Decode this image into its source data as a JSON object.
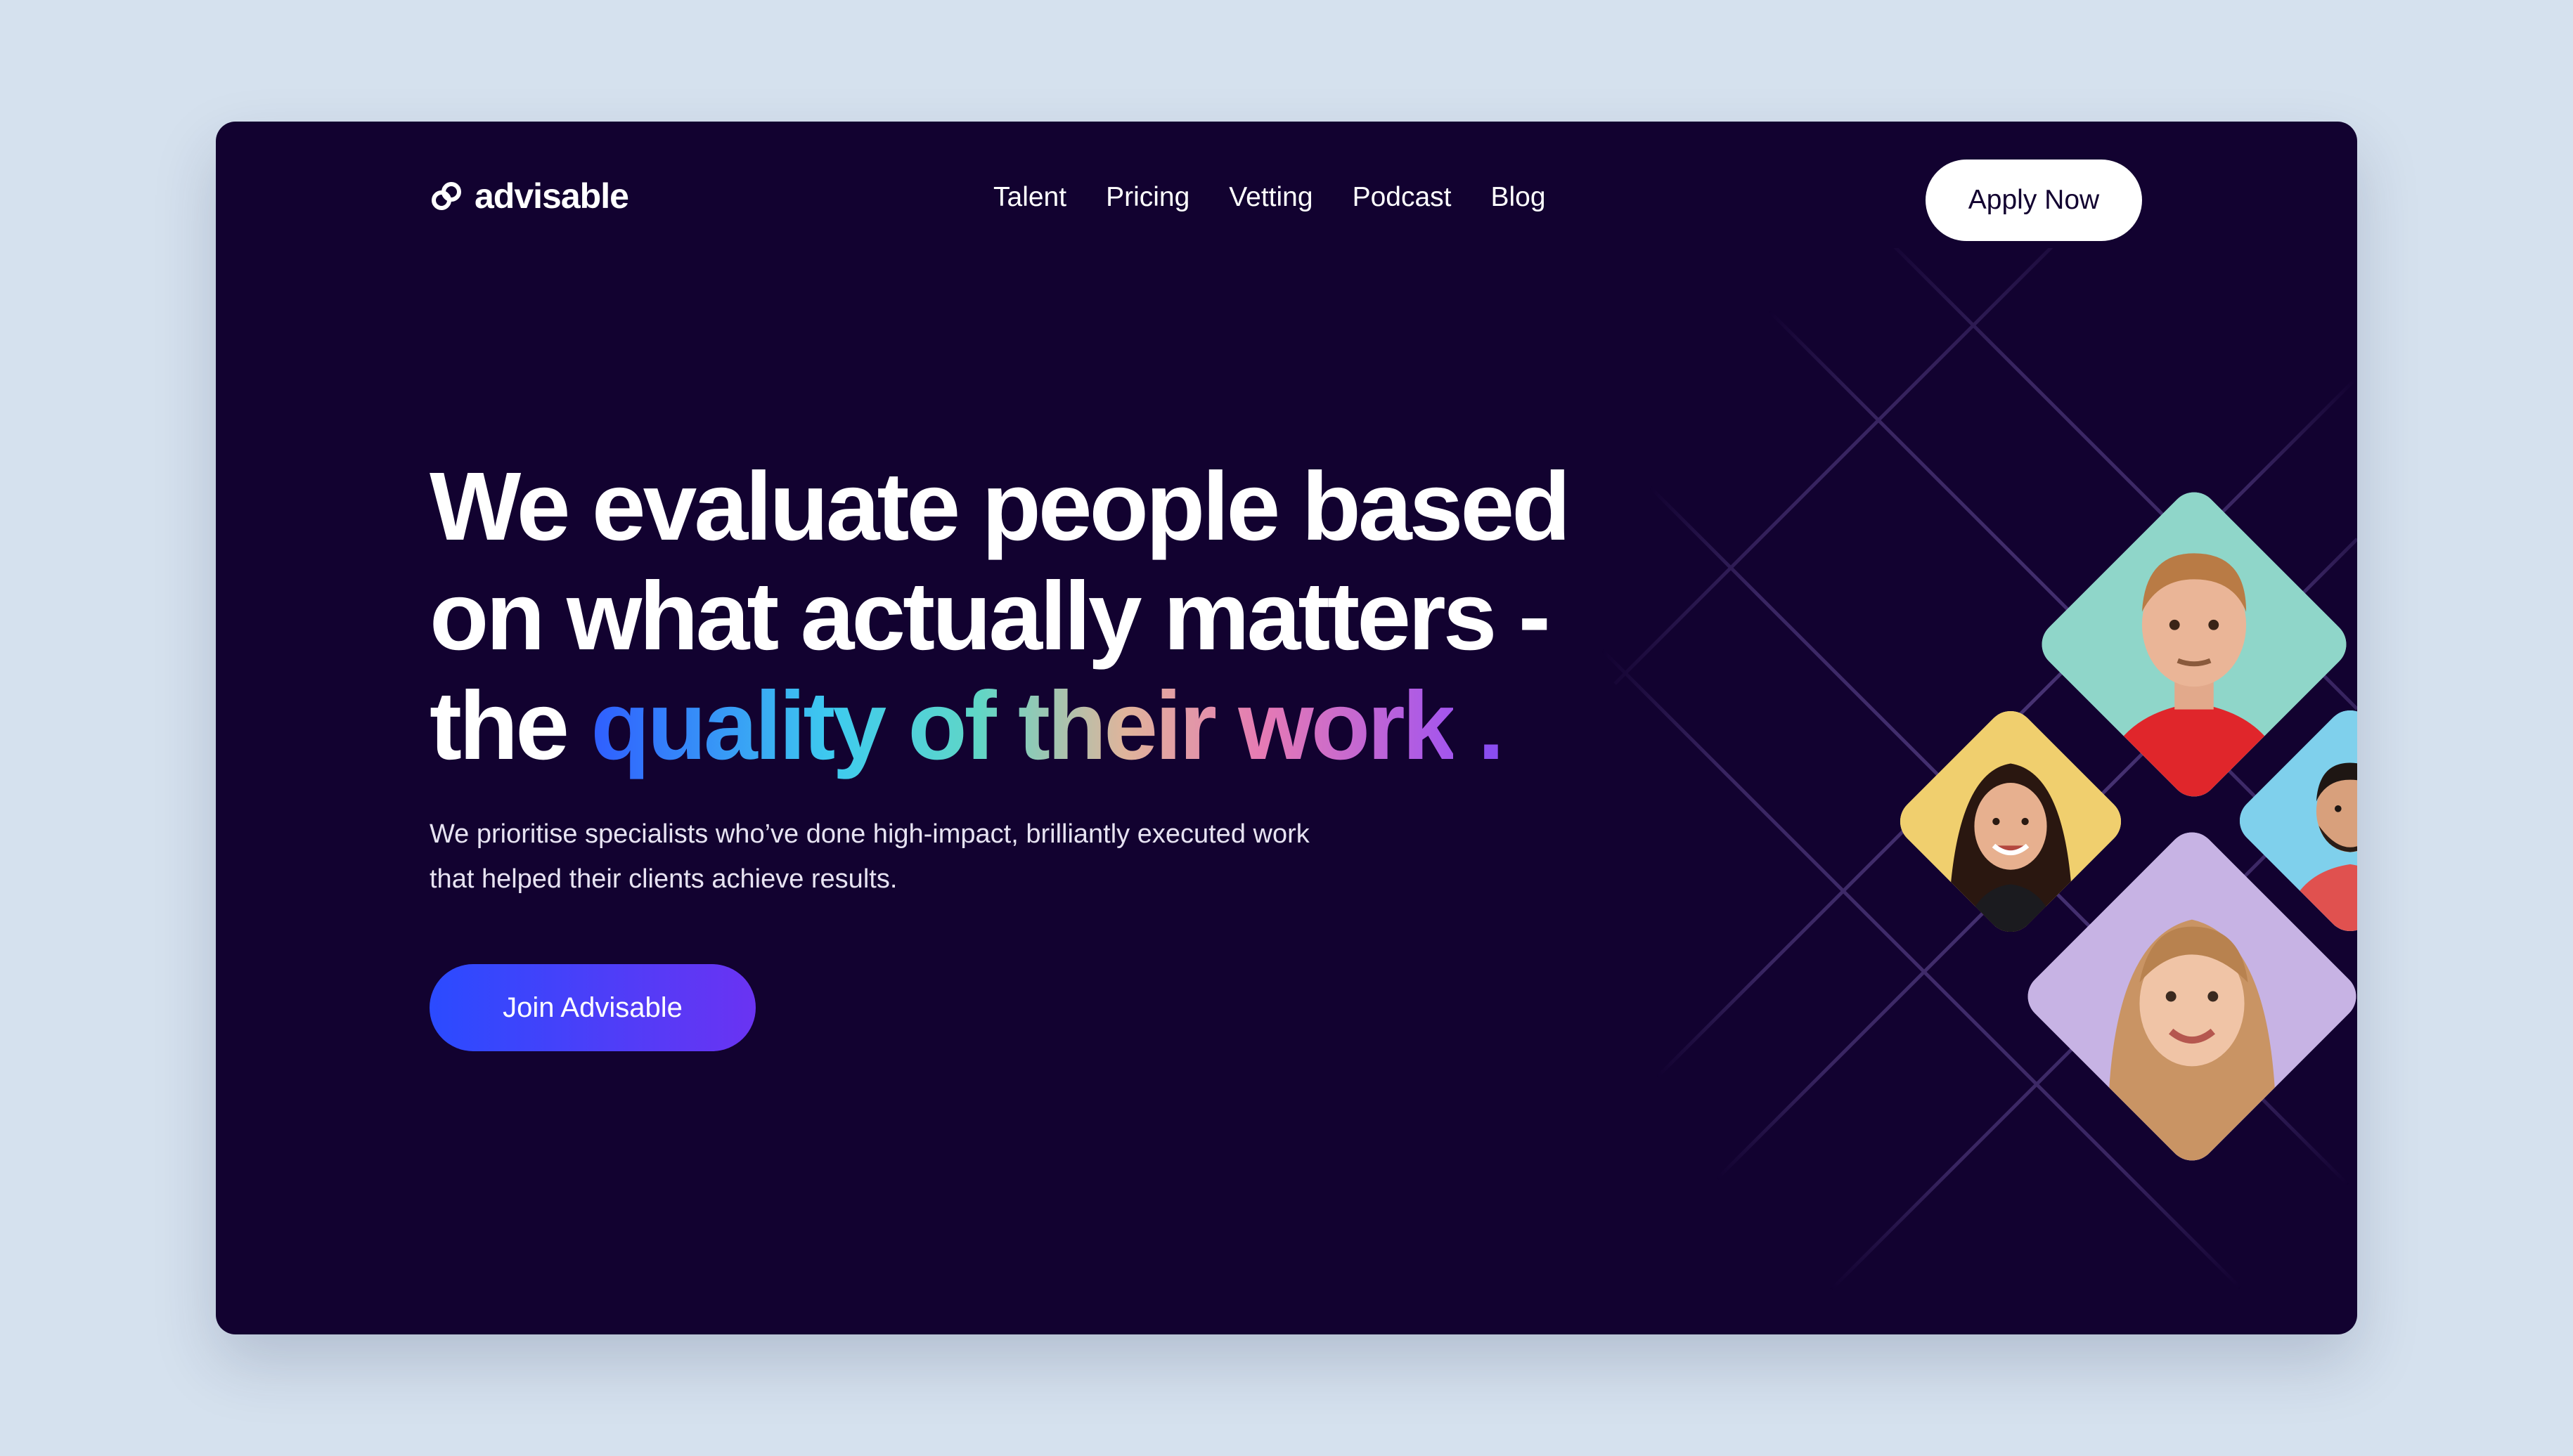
{
  "brand": {
    "name": "advisable",
    "logo_icon": "linked-rings-icon"
  },
  "nav": {
    "items": [
      "Talent",
      "Pricing",
      "Vetting",
      "Podcast",
      "Blog"
    ],
    "cta_label": "Apply Now"
  },
  "hero": {
    "headline_line1": "We evaluate people based",
    "headline_line2": "on what actually matters -",
    "headline_line3_plain": "the ",
    "headline_line3_gradient": "quality of their work",
    "headline_line3_end": " .",
    "subtitle": "We prioritise specialists who’ve done high-impact, brilliantly executed work that helped their clients achieve results.",
    "cta_label": "Join Advisable"
  },
  "colors": {
    "background": "#120230",
    "page": "#d5e1ee",
    "accent_start": "#2b4bff",
    "accent_end": "#6a33f2",
    "portrait_tiles": [
      "#8fd6c9",
      "#f0cf6e",
      "#7fd0ec",
      "#c7b3e4"
    ]
  },
  "portraits": [
    {
      "name": "portrait-man-red-polo",
      "tile_color": "#8fd6c9"
    },
    {
      "name": "portrait-woman-dark-hair",
      "tile_color": "#f0cf6e"
    },
    {
      "name": "portrait-man-beard",
      "tile_color": "#7fd0ec"
    },
    {
      "name": "portrait-woman-blonde",
      "tile_color": "#c7b3e4"
    }
  ]
}
